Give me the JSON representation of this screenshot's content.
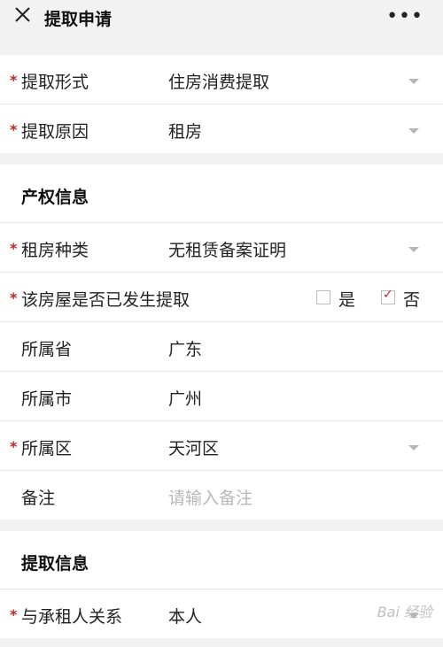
{
  "header": {
    "title": "提取申请",
    "more": "•••"
  },
  "form1": [
    {
      "label": "提取形式",
      "value": "住房消费提取",
      "required": true
    },
    {
      "label": "提取原因",
      "value": "租房",
      "required": true
    }
  ],
  "section_property": {
    "title": "产权信息",
    "rent_type": {
      "label": "租房种类",
      "value": "无租赁备案证明"
    },
    "withdrawn": {
      "label": "该房屋是否已发生提取",
      "yes": "是",
      "no": "否",
      "selected": "否"
    },
    "province": {
      "label": "所属省",
      "value": "广东"
    },
    "city": {
      "label": "所属市",
      "value": "广州"
    },
    "district": {
      "label": "所属区",
      "value": "天河区"
    },
    "remark": {
      "label": "备注",
      "placeholder": "请输入备注"
    }
  },
  "section_withdraw": {
    "title": "提取信息",
    "relation": {
      "label": "与承租人关系",
      "value": "本人"
    }
  },
  "watermark": "Bai 经验"
}
